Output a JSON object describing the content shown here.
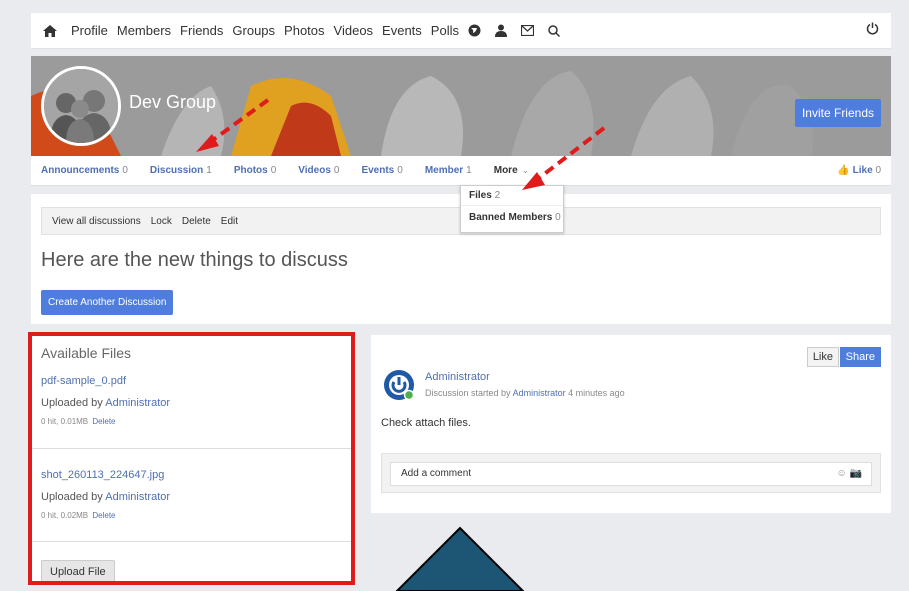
{
  "topnav": {
    "items": [
      "Profile",
      "Members",
      "Friends",
      "Groups",
      "Photos",
      "Videos",
      "Events",
      "Polls"
    ],
    "icons": [
      "home-icon",
      "globe-icon",
      "person-icon",
      "mail-icon",
      "search-icon",
      "power-icon"
    ]
  },
  "cover": {
    "group_name": "Dev Group",
    "invite_label": "Invite Friends"
  },
  "tabs": {
    "items": [
      {
        "label": "Announcements",
        "count": "0"
      },
      {
        "label": "Discussion",
        "count": "1"
      },
      {
        "label": "Photos",
        "count": "0"
      },
      {
        "label": "Videos",
        "count": "0"
      },
      {
        "label": "Events",
        "count": "0"
      },
      {
        "label": "Member",
        "count": "1"
      },
      {
        "label": "More",
        "count": ""
      }
    ],
    "like_label": "Like",
    "like_count": "0"
  },
  "more_menu": {
    "items": [
      {
        "label": "Files",
        "count": "2"
      },
      {
        "label": "Banned Members",
        "count": "0"
      }
    ]
  },
  "discussion": {
    "actions": [
      "View all discussions",
      "Lock",
      "Delete",
      "Edit"
    ],
    "title": "Here are the new things to discuss",
    "create_label": "Create Another Discussion"
  },
  "files": {
    "title": "Available Files",
    "items": [
      {
        "name": "pdf-sample_0.pdf",
        "uploaded_prefix": "Uploaded by",
        "uploader": "Administrator",
        "meta": "0 hit, 0.01MB",
        "delete": "Delete"
      },
      {
        "name": "shot_260113_224647.jpg",
        "uploaded_prefix": "Uploaded by",
        "uploader": "Administrator",
        "meta": "0 hit, 0.02MB",
        "delete": "Delete"
      }
    ],
    "upload_label": "Upload File"
  },
  "post": {
    "like_label": "Like",
    "share_label": "Share",
    "author": "Administrator",
    "sub_prefix": "Discussion started by",
    "sub_author": "Administrator",
    "sub_time": "4 minutes ago",
    "body": "Check attach files.",
    "comment_placeholder": "Add a comment"
  },
  "colors": {
    "accent": "#4f7dde",
    "link": "#4f6fb3",
    "highlight": "#e01b1b",
    "overlay_arrow": "#1d5575"
  }
}
